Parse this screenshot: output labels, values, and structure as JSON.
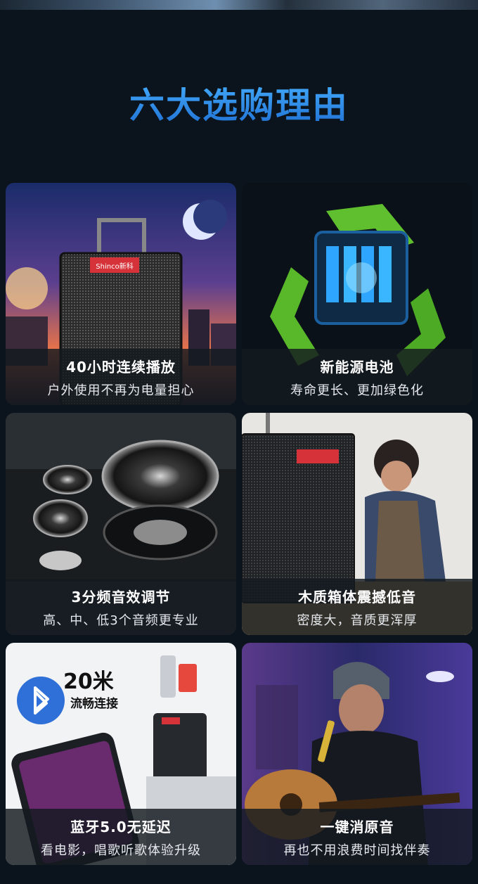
{
  "page": {
    "title": "六大选购理由",
    "title_color": "#2f8fe6",
    "background": "#0b141c"
  },
  "cards": [
    {
      "title": "40小时连续播放",
      "subtitle": "户外使用不再为电量担心",
      "icon": "speaker-sunset-image"
    },
    {
      "title": "新能源电池",
      "subtitle": "寿命更长、更加绿色化",
      "icon": "recycle-battery-image"
    },
    {
      "title": "3分频音效调节",
      "subtitle": "高、中、低3个音频更专业",
      "icon": "speaker-drivers-image"
    },
    {
      "title": "木质箱体震撼低音",
      "subtitle": "密度大，音质更浑厚",
      "icon": "wood-cabinet-image"
    },
    {
      "title": "蓝牙5.0无延迟",
      "subtitle": "看电影，唱歌听歌体验升级",
      "icon": "bluetooth-phone-image"
    },
    {
      "title": "一键消原音",
      "subtitle": "再也不用浪费时间找伴奏",
      "icon": "singer-guitar-image"
    }
  ],
  "badges": {
    "brand": "Shinco新科",
    "bluetooth_range": "20米",
    "bluetooth_range_sub": "流畅连接"
  }
}
